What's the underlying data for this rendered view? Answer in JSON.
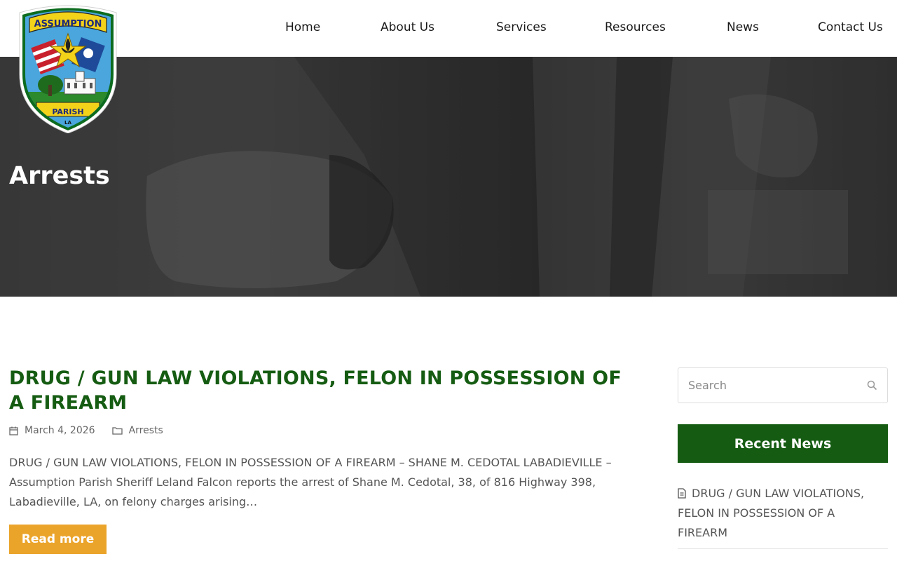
{
  "logo": {
    "top_text": "ASSUMPTION",
    "bottom_text": "PARISH",
    "state_text": "LA"
  },
  "nav": {
    "items": [
      "Home",
      "About Us",
      "Services",
      "Resources",
      "News",
      "Contact Us"
    ]
  },
  "hero": {
    "title": "Arrests"
  },
  "post": {
    "title": "DRUG / GUN LAW VIOLATIONS, FELON IN POSSESSION OF A FIREARM",
    "date": "March 4, 2026",
    "category": "Arrests",
    "excerpt": "DRUG / GUN LAW VIOLATIONS, FELON IN POSSESSION OF A FIREARM – SHANE M. CEDOTAL LABADIEVILLE – Assumption Parish Sheriff Leland Falcon reports the arrest of Shane M. Cedotal, 38, of 816 Highway 398, Labadieville, LA, on felony charges arising…",
    "read_more": "Read more"
  },
  "sidebar": {
    "search_placeholder": "Search",
    "recent_heading": "Recent News",
    "recent_items": [
      "DRUG / GUN LAW VIOLATIONS, FELON IN POSSESSION OF A FIREARM"
    ]
  },
  "colors": {
    "brand_green": "#155c12",
    "accent_orange": "#eba42a"
  }
}
